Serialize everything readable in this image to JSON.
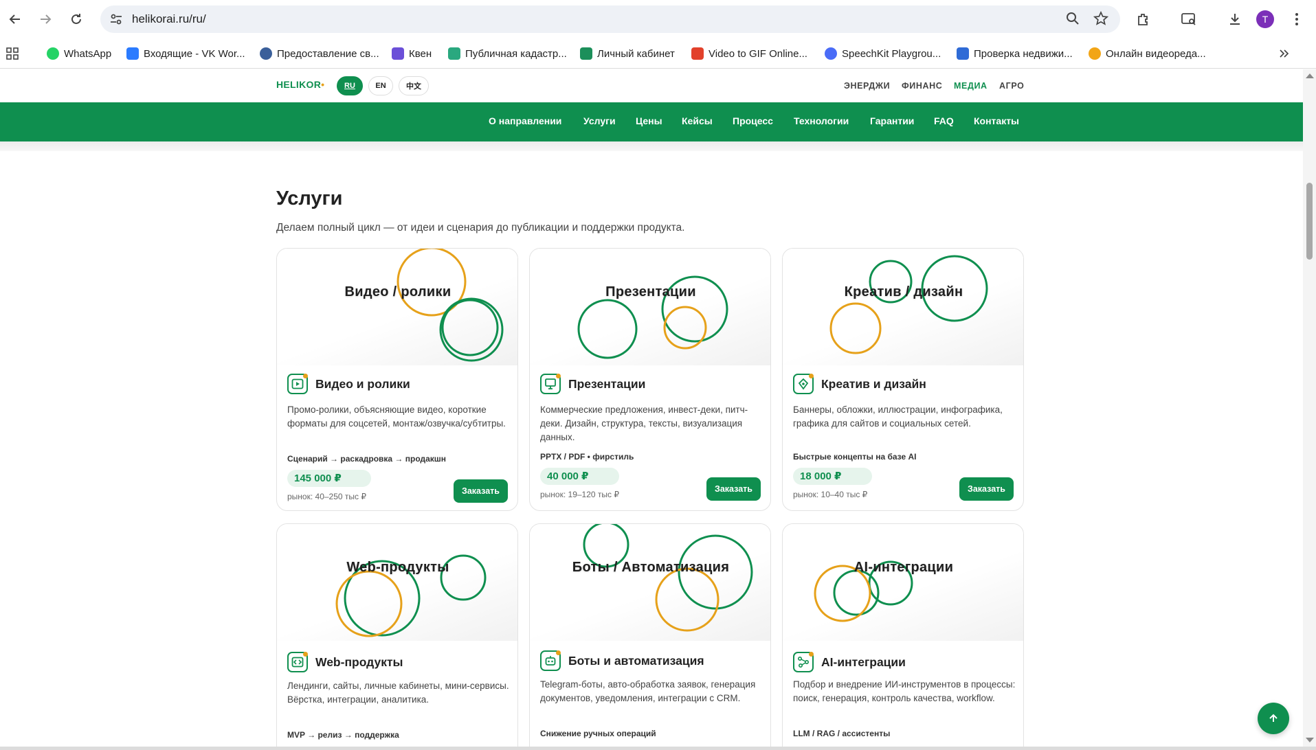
{
  "browser": {
    "url": "helikorai.ru/ru/",
    "avatar_letter": "T",
    "bookmarks": [
      {
        "label": "WhatsApp",
        "color": "#25d366"
      },
      {
        "label": "Входящие - VK Wor...",
        "color": "#2b7bff"
      },
      {
        "label": "Предоставление св...",
        "color": "#3a5f9a"
      },
      {
        "label": "Квен",
        "color": "#6b4fd8"
      },
      {
        "label": "Публичная кадастр...",
        "color": "#2aa87f"
      },
      {
        "label": "Личный кабинет",
        "color": "#1c8f5a"
      },
      {
        "label": "Video to GIF Online...",
        "color": "#e2412b"
      },
      {
        "label": "SpeechKit Playgrou...",
        "color": "#4a6cf7"
      },
      {
        "label": "Проверка недвижи...",
        "color": "#2f6bd6"
      },
      {
        "label": "Онлайн видеореда...",
        "color": "#f2a516"
      }
    ]
  },
  "site": {
    "logo": "HELIKOR",
    "langs": [
      "RU",
      "EN",
      "中文"
    ],
    "top_links": [
      "ЭНЕРДЖИ",
      "ФИНАНС",
      "МЕДИА",
      "АГРО"
    ],
    "active_top_link": "МЕДИА",
    "nav": [
      "О направлении",
      "Услуги",
      "Цены",
      "Кейсы",
      "Процесс",
      "Технологии",
      "Гарантии",
      "FAQ",
      "Контакты"
    ]
  },
  "section": {
    "title": "Услуги",
    "subtitle": "Делаем полный цикл — от идеи и сценария до публикации и поддержки продукта."
  },
  "cards": [
    {
      "banner": "Видео / ролики",
      "title": "Видео и ролики",
      "desc": "Промо-ролики, объясняющие видео, короткие форматы для соцсетей, монтаж/озвучка/субтитры.",
      "tag": "Сценарий → раскадровка → продакшн",
      "price": "145 000 ₽",
      "market": "рынок: 40–250 тыс ₽",
      "button": "Заказать",
      "icon": "video-play-icon"
    },
    {
      "banner": "Презентации",
      "title": "Презентации",
      "desc": "Коммерческие предложения, инвест-деки, питч-деки. Дизайн, структура, тексты, визуализация данных.",
      "tag": "PPTX / PDF • фирстиль",
      "price": "40 000 ₽",
      "market": "рынок: 19–120 тыс ₽",
      "button": "Заказать",
      "icon": "presentation-icon"
    },
    {
      "banner": "Креатив / дизайн",
      "title": "Креатив и дизайн",
      "desc": "Баннеры, обложки, иллюстрации, инфографика, графика для сайтов и социальных сетей.",
      "tag": "Быстрые концепты на базе AI",
      "price": "18 000 ₽",
      "market": "рынок: 10–40 тыс ₽",
      "button": "Заказать",
      "icon": "pen-tool-icon"
    },
    {
      "banner": "Web-продукты",
      "title": "Web-продукты",
      "desc": "Лендинги, сайты, личные кабинеты, мини-сервисы. Вёрстка, интеграции, аналитика.",
      "tag": "MVP → релиз → поддержка",
      "icon": "code-icon"
    },
    {
      "banner": "Боты / Автоматизация",
      "title": "Боты и автоматизация",
      "desc": "Telegram-боты, авто-обработка заявок, генерация документов, уведомления, интеграции с CRM.",
      "tag": "Снижение ручных операций",
      "icon": "bot-icon"
    },
    {
      "banner": "AI-интеграции",
      "title": "AI-интеграции",
      "desc": "Подбор и внедрение ИИ-инструментов в процессы: поиск, генерация, контроль качества, workflow.",
      "tag": "LLM / RAG / ассистенты",
      "icon": "network-icon"
    }
  ],
  "colors": {
    "brand_green": "#0f8f4f",
    "accent_orange": "#e6a11a"
  }
}
